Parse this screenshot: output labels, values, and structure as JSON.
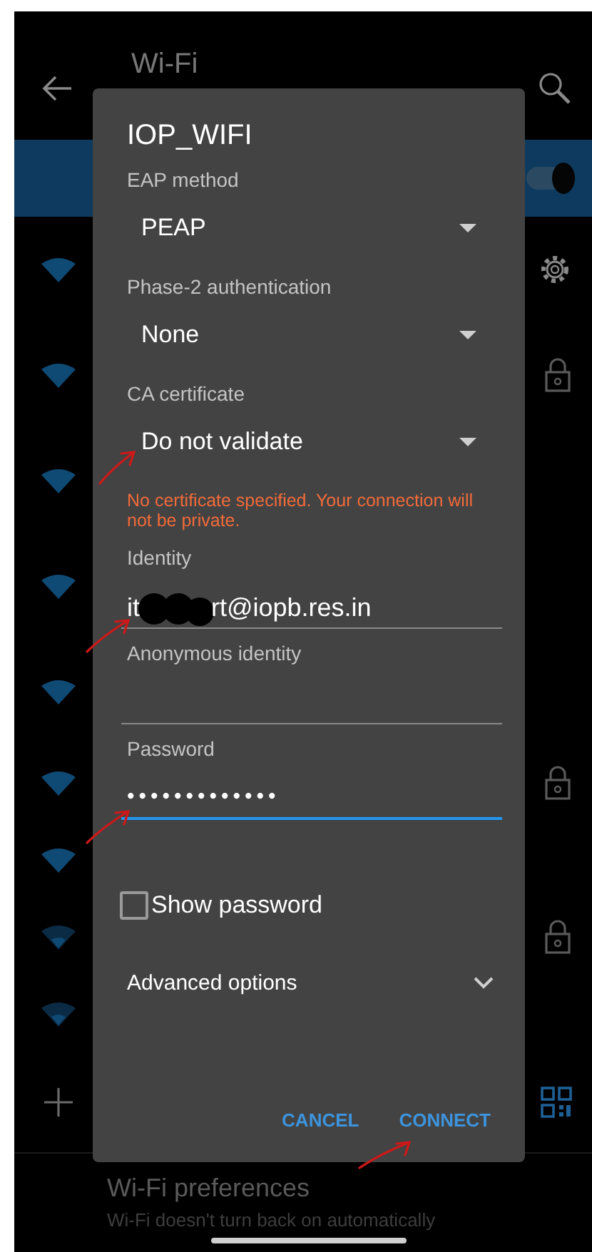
{
  "app_bar": {
    "title": "Wi-Fi"
  },
  "wifi_master": {
    "on": true
  },
  "networks": [
    {
      "kind": "full",
      "settings": true,
      "locked": false
    },
    {
      "kind": "full",
      "settings": false,
      "locked": true
    },
    {
      "kind": "full",
      "settings": false,
      "locked": false
    },
    {
      "kind": "full",
      "settings": false,
      "locked": false
    },
    {
      "kind": "full",
      "settings": false,
      "locked": false
    },
    {
      "kind": "full",
      "settings": false,
      "locked": true
    },
    {
      "kind": "full",
      "settings": false,
      "locked": false
    },
    {
      "kind": "weak",
      "settings": false,
      "locked": true
    },
    {
      "kind": "weak",
      "settings": false,
      "locked": false
    }
  ],
  "preferences": {
    "title": "Wi-Fi preferences",
    "subtitle": "Wi-Fi doesn't turn back on automatically"
  },
  "dialog": {
    "title": "IOP_WIFI",
    "fields": [
      {
        "kind": "spinner",
        "label": "EAP method",
        "value": "PEAP",
        "marked": false
      },
      {
        "kind": "spinner",
        "label": "Phase-2 authentication",
        "value": "None",
        "marked": false
      },
      {
        "kind": "spinner",
        "label": "CA certificate",
        "value": "Do not validate",
        "marked": true,
        "error": "No certificate specified. Your connection will not be private."
      },
      {
        "kind": "text",
        "label": "Identity",
        "value_start": "it",
        "value_end": "rt@iopb.res.in",
        "redacted": true,
        "focused": false,
        "marked": true
      },
      {
        "kind": "text",
        "label": "Anonymous identity",
        "focused": false,
        "marked": false
      },
      {
        "kind": "password",
        "label": "Password",
        "value": "•••••••••••••",
        "focused": true,
        "marked": true
      }
    ],
    "show_password": {
      "label": "Show password",
      "checked": false
    },
    "advanced": {
      "label": "Advanced options",
      "expanded": false
    },
    "buttons": [
      {
        "label": "CANCEL",
        "marked": false
      },
      {
        "label": "CONNECT",
        "marked": true
      }
    ]
  }
}
